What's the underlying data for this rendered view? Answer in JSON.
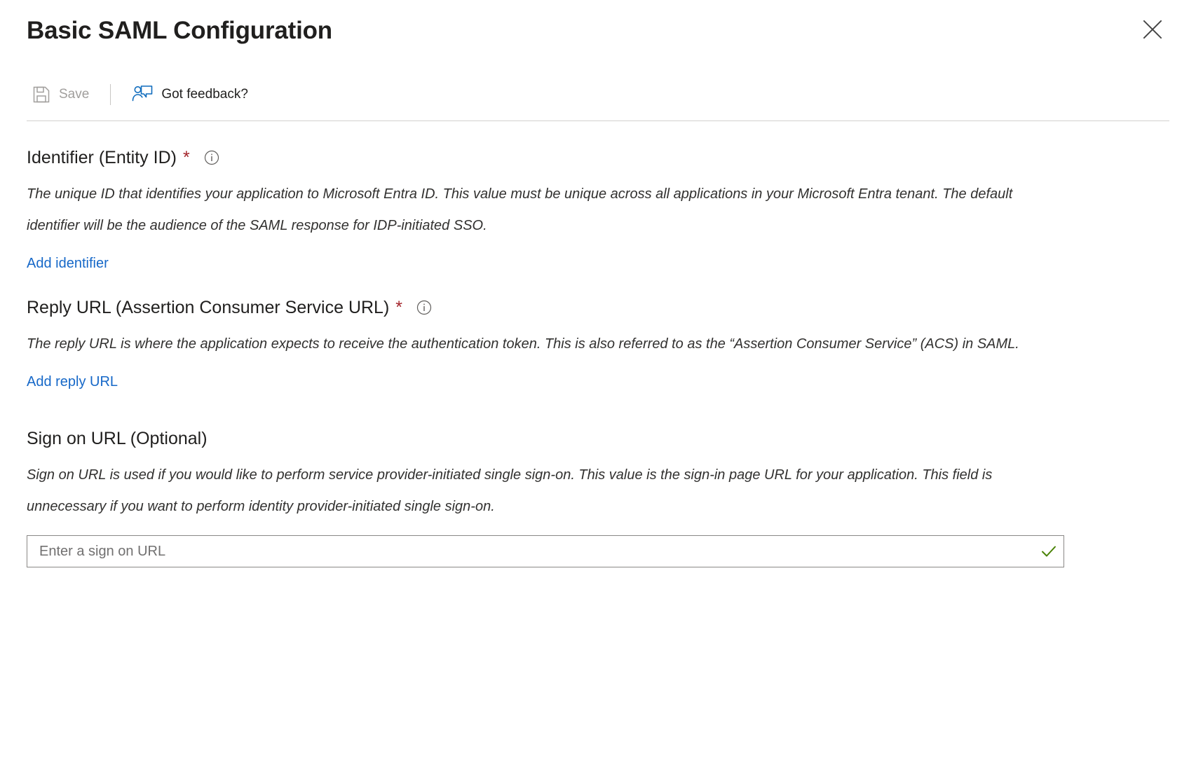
{
  "header": {
    "title": "Basic SAML Configuration",
    "close_icon": "close-icon"
  },
  "toolbar": {
    "save_label": "Save",
    "save_icon": "save-floppy-disk-icon",
    "save_disabled": true,
    "feedback_label": "Got feedback?",
    "feedback_icon": "feedback-person-icon"
  },
  "colors": {
    "link": "#1668c8",
    "required_star": "#a4262c",
    "valid_check": "#498205",
    "disabled_text": "#a19f9d",
    "border": "#8a8886",
    "divider": "#d2d0ce"
  },
  "fields": [
    {
      "label": "Identifier (Entity ID)",
      "required": true,
      "required_marker": "*",
      "info_icon": "info-circle-icon",
      "description": "The unique ID that identifies your application to Microsoft Entra ID. This value must be unique across all applications in your Microsoft Entra tenant. The default identifier will be the audience of the SAML response for IDP-initiated SSO.",
      "add_link": "Add identifier"
    },
    {
      "label": "Reply URL (Assertion Consumer Service URL)",
      "required": true,
      "required_marker": "*",
      "info_icon": "info-circle-icon",
      "description": "The reply URL is where the application expects to receive the authentication token. This is also referred to as the “Assertion Consumer Service” (ACS) in SAML.",
      "add_link": "Add reply URL"
    },
    {
      "label": "Sign on URL (Optional)",
      "required": false,
      "description": "Sign on URL is used if you would like to perform service provider-initiated single sign-on. This value is the sign-in page URL for your application. This field is unnecessary if you want to perform identity provider-initiated single sign-on.",
      "input": {
        "value": "",
        "placeholder": "Enter a sign on URL",
        "valid_icon": "checkmark-icon"
      }
    }
  ]
}
